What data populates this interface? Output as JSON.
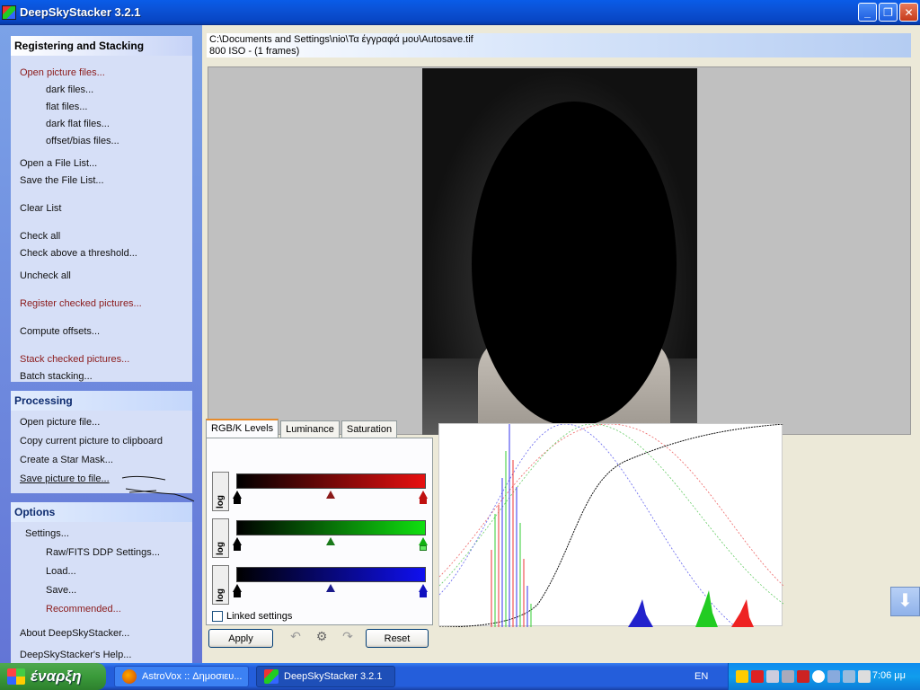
{
  "window": {
    "title": "DeepSkyStacker 3.2.1",
    "buttons": [
      "_",
      "❐",
      "✕"
    ]
  },
  "taskpane": {
    "registering": {
      "header": "Registering and Stacking",
      "items": [
        "Open picture files...",
        "dark files...",
        "flat files...",
        "dark flat files...",
        "offset/bias files...",
        "Open a File List...",
        "Save the File List...",
        "Clear List",
        "Check all",
        "Check above a threshold...",
        "Uncheck all",
        "Register checked pictures...",
        "Compute offsets...",
        "Stack checked pictures...",
        "Batch stacking..."
      ]
    },
    "processing": {
      "header": "Processing",
      "items": [
        "Open picture file...",
        "Copy current picture to clipboard",
        "Create a Star Mask...",
        "Save picture to file..."
      ]
    },
    "options": {
      "header": "Options",
      "items": [
        "Settings...",
        "Raw/FITS DDP Settings...",
        "Load...",
        "Save...",
        "Recommended...",
        "About DeepSkyStacker...",
        "DeepSkyStacker's Help..."
      ]
    }
  },
  "file_info": {
    "path": "C:\\Documents and Settings\\nio\\Τα έγγραφά μου\\Autosave.tif",
    "details": "800 ISO - (1 frames)"
  },
  "levels": {
    "tabs": [
      "RGB/K Levels",
      "Luminance",
      "Saturation"
    ],
    "active_tab": 0,
    "log_label": "log",
    "channels": [
      {
        "name": "red",
        "color": "#e81010",
        "midpoint": 0.5
      },
      {
        "name": "green",
        "color": "#10e010",
        "midpoint": 0.5
      },
      {
        "name": "blue",
        "color": "#1010f0",
        "midpoint": 0.5
      }
    ],
    "linked_label": "Linked settings",
    "linked_checked": false,
    "apply_label": "Apply",
    "reset_label": "Reset"
  },
  "taskbar": {
    "start_label": "έναρξη",
    "tasks": [
      {
        "label": "AstroVox :: Δημοσιευ...",
        "active": false
      },
      {
        "label": "DeepSkyStacker 3.2.1",
        "active": true
      }
    ],
    "language": "EN",
    "clock": "7:06 μμ"
  },
  "colors": {
    "accent": "#245edb",
    "pane": "#6375d6",
    "red_item": "#8b1a1a"
  }
}
